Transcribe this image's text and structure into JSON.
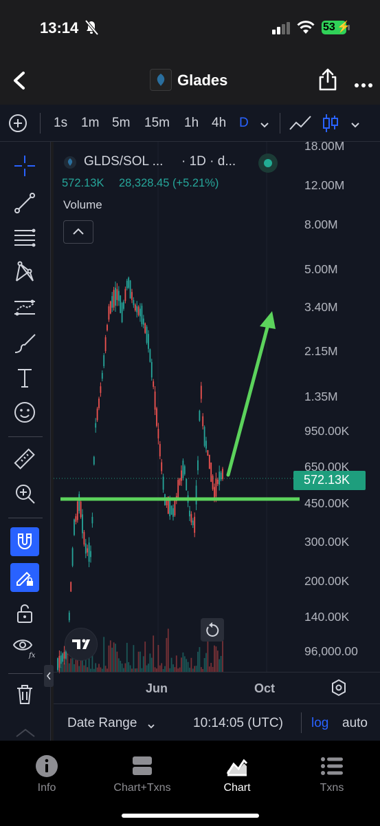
{
  "status": {
    "time": "13:14",
    "battery": "53"
  },
  "nav": {
    "title": "Glades"
  },
  "toolbar": {
    "intervals": [
      "1s",
      "1m",
      "5m",
      "15m",
      "1h",
      "4h",
      "D"
    ]
  },
  "legend": {
    "symbol": "GLDS/SOL ...",
    "suffix": "· 1D · d...",
    "price": "572.13K",
    "change": "28,328.45 (+5.21%)",
    "volume_label": "Volume"
  },
  "price_axis": {
    "labels": [
      "18.00M",
      "12.00M",
      "8.00M",
      "5.00M",
      "3.40M",
      "2.15M",
      "1.35M",
      "950.00K",
      "650.00K",
      "450.00K",
      "300.00K",
      "200.00K",
      "140.00K",
      "96,000.00"
    ],
    "current": "572.13K"
  },
  "time_axis": {
    "labels": [
      "Jun",
      "Oct"
    ]
  },
  "bottom": {
    "date_range": "Date Range",
    "clock": "10:14:05 (UTC)",
    "log": "log",
    "auto": "auto"
  },
  "tabs": [
    {
      "label": "Info",
      "icon": "info-icon"
    },
    {
      "label": "Chart+Txns",
      "icon": "split-view-icon"
    },
    {
      "label": "Chart",
      "icon": "chart-icon"
    },
    {
      "label": "Txns",
      "icon": "list-icon"
    }
  ],
  "colors": {
    "up": "#26a69a",
    "down": "#ef5350",
    "annotation": "#5cd35c",
    "accent": "#2962ff",
    "price_tag": "#1e9e7d"
  },
  "chart_data": {
    "type": "candlestick",
    "interval": "1D",
    "scale": "log",
    "ylim": [
      90000,
      18000000
    ],
    "annotations": [
      {
        "type": "horizontal-line",
        "value": 480000
      },
      {
        "type": "arrow",
        "from": 560000,
        "to": 3500000
      }
    ]
  }
}
